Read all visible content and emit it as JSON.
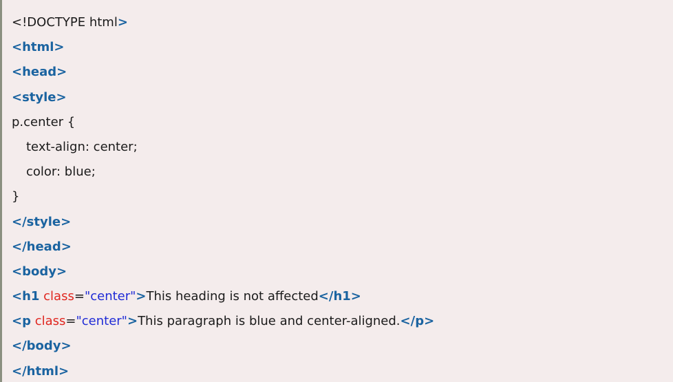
{
  "code_lines": {
    "l0": {
      "text": "<!DOCTYPE html",
      "close": ">"
    },
    "l1": {
      "tag": "<html>"
    },
    "l2": {
      "tag": "<head>"
    },
    "l3": {
      "tag": "<style>"
    },
    "l4": {
      "text": "p.center {"
    },
    "l5": {
      "text": "text-align: center;"
    },
    "l6": {
      "text": "color: blue;"
    },
    "l7": {
      "text": "}"
    },
    "l8": {
      "tag": "</style>"
    },
    "l9": {
      "tag": "</head>"
    },
    "l10": {
      "tag": "<body>"
    },
    "l11": {
      "open": "<h1",
      "attr": "class",
      "eq": "=",
      "value": "\"center\"",
      "open_close": ">",
      "content": "This heading is not affected",
      "close_tag": "</h1>"
    },
    "l12": {
      "open": "<p",
      "attr": "class",
      "eq": "=",
      "value": "\"center\"",
      "open_close": ">",
      "content": "This paragraph is blue and center-aligned.",
      "close_tag": "</p>"
    },
    "l13": {
      "tag": "</body>"
    },
    "l14": {
      "tag": "</html>"
    }
  },
  "colors": {
    "background": "#f4ecec",
    "tag": "#1a63a0",
    "attribute": "#e0261f",
    "value": "#1f2bd6",
    "text": "#1a1a1a",
    "left_border": "#8a8f80"
  }
}
